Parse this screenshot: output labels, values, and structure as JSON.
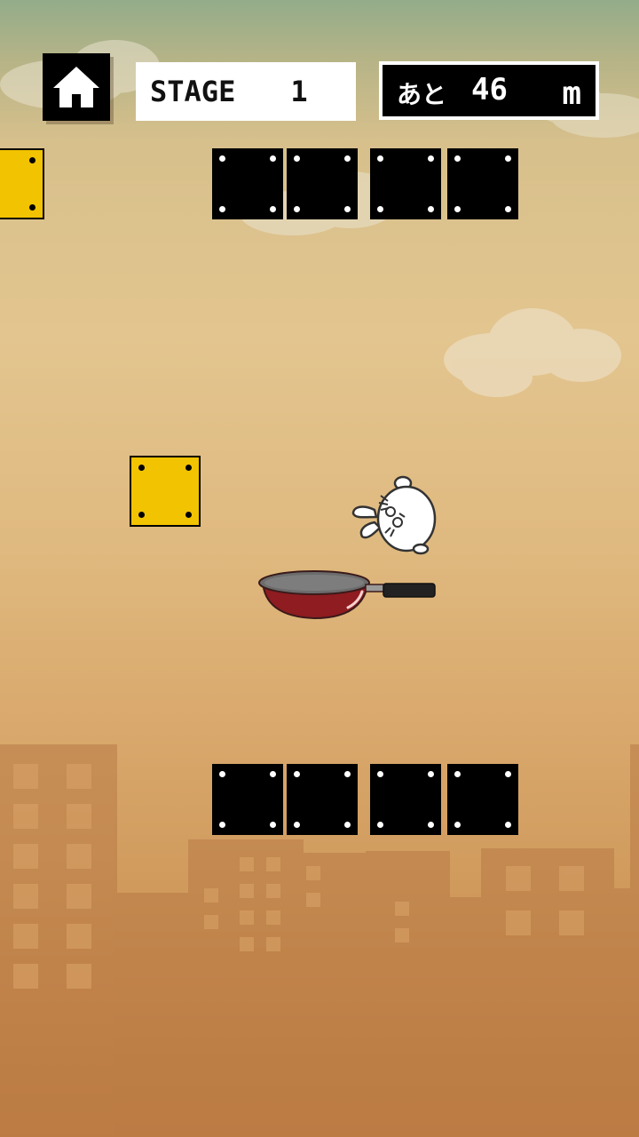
{
  "hud": {
    "home_icon": "home-icon",
    "stage_label": "STAGE",
    "stage_number": "1",
    "remaining_label": "あと",
    "remaining_value": "46",
    "remaining_unit": "m"
  },
  "colors": {
    "block_black": "#000000",
    "block_yellow": "#f2c300",
    "pan_red": "#8e1c20",
    "sky_top": "#93ac8a",
    "ground": "#c07d42"
  },
  "game": {
    "player": "white-cat-character",
    "platform": "frying-pan"
  }
}
